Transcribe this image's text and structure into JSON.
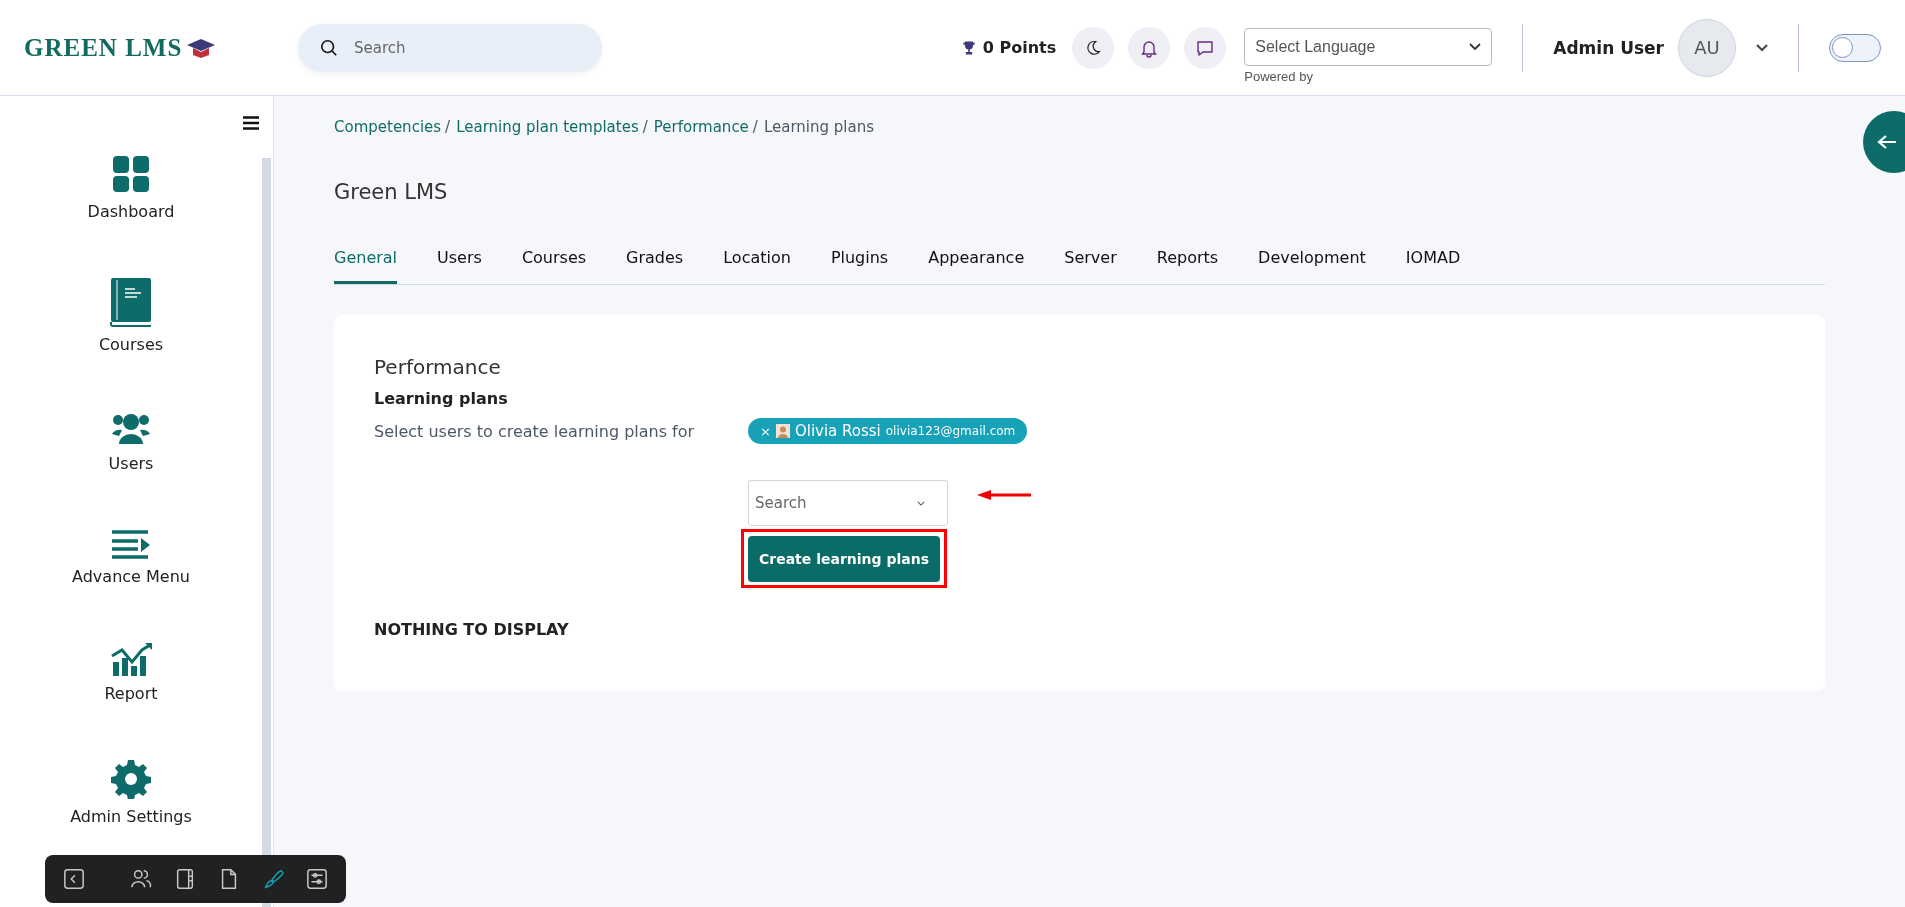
{
  "header": {
    "logo": "GREEN LMS",
    "search": {
      "placeholder": "Search"
    },
    "points": "0 Points",
    "language": {
      "value": "Select Language",
      "note": "Powered by"
    },
    "user": {
      "name": "Admin User",
      "initials": "AU"
    },
    "theme_toggle": {
      "on": false
    }
  },
  "sidebar": {
    "items": [
      {
        "label": "Dashboard",
        "kind": "dashboard"
      },
      {
        "label": "Courses",
        "kind": "courses"
      },
      {
        "label": "Users",
        "kind": "users"
      },
      {
        "label": "Advance Menu",
        "kind": "menu"
      },
      {
        "label": "Report",
        "kind": "report"
      },
      {
        "label": "Admin Settings",
        "kind": "settings"
      }
    ]
  },
  "breadcrumb": [
    {
      "label": "Competencies",
      "link": true,
      "separator": "/"
    },
    {
      "label": "Learning plan templates",
      "link": true,
      "separator": "/"
    },
    {
      "label": "Performance",
      "link": true,
      "separator": "/"
    },
    {
      "label": "Learning plans",
      "link": false
    }
  ],
  "page_title": "Green LMS",
  "tabs": [
    {
      "label": "General",
      "selected": true
    },
    {
      "label": "Users",
      "selected": false
    },
    {
      "label": "Courses",
      "selected": false
    },
    {
      "label": "Grades",
      "selected": false
    },
    {
      "label": "Location",
      "selected": false
    },
    {
      "label": "Plugins",
      "selected": false
    },
    {
      "label": "Appearance",
      "selected": false
    },
    {
      "label": "Server",
      "selected": false
    },
    {
      "label": "Reports",
      "selected": false
    },
    {
      "label": "Development",
      "selected": false
    },
    {
      "label": "IOMAD",
      "selected": false
    }
  ],
  "card": {
    "heading": "Performance",
    "subheading": "Learning plans",
    "field_label": "Select users to create learning plans for",
    "chips": [
      {
        "remove": "×",
        "name": "Olivia Rossi",
        "email": "olivia123@gmail.com"
      }
    ],
    "search": {
      "placeholder": "Search"
    },
    "button": "Create learning plans",
    "empty": "NOTHING TO DISPLAY"
  },
  "toolbar": [
    {
      "kind": "back",
      "selected": false
    },
    {
      "kind": "users",
      "selected": false
    },
    {
      "kind": "notebook",
      "selected": false
    },
    {
      "kind": "page",
      "selected": false
    },
    {
      "kind": "brush",
      "selected": true
    },
    {
      "kind": "sliders",
      "selected": false
    }
  ]
}
